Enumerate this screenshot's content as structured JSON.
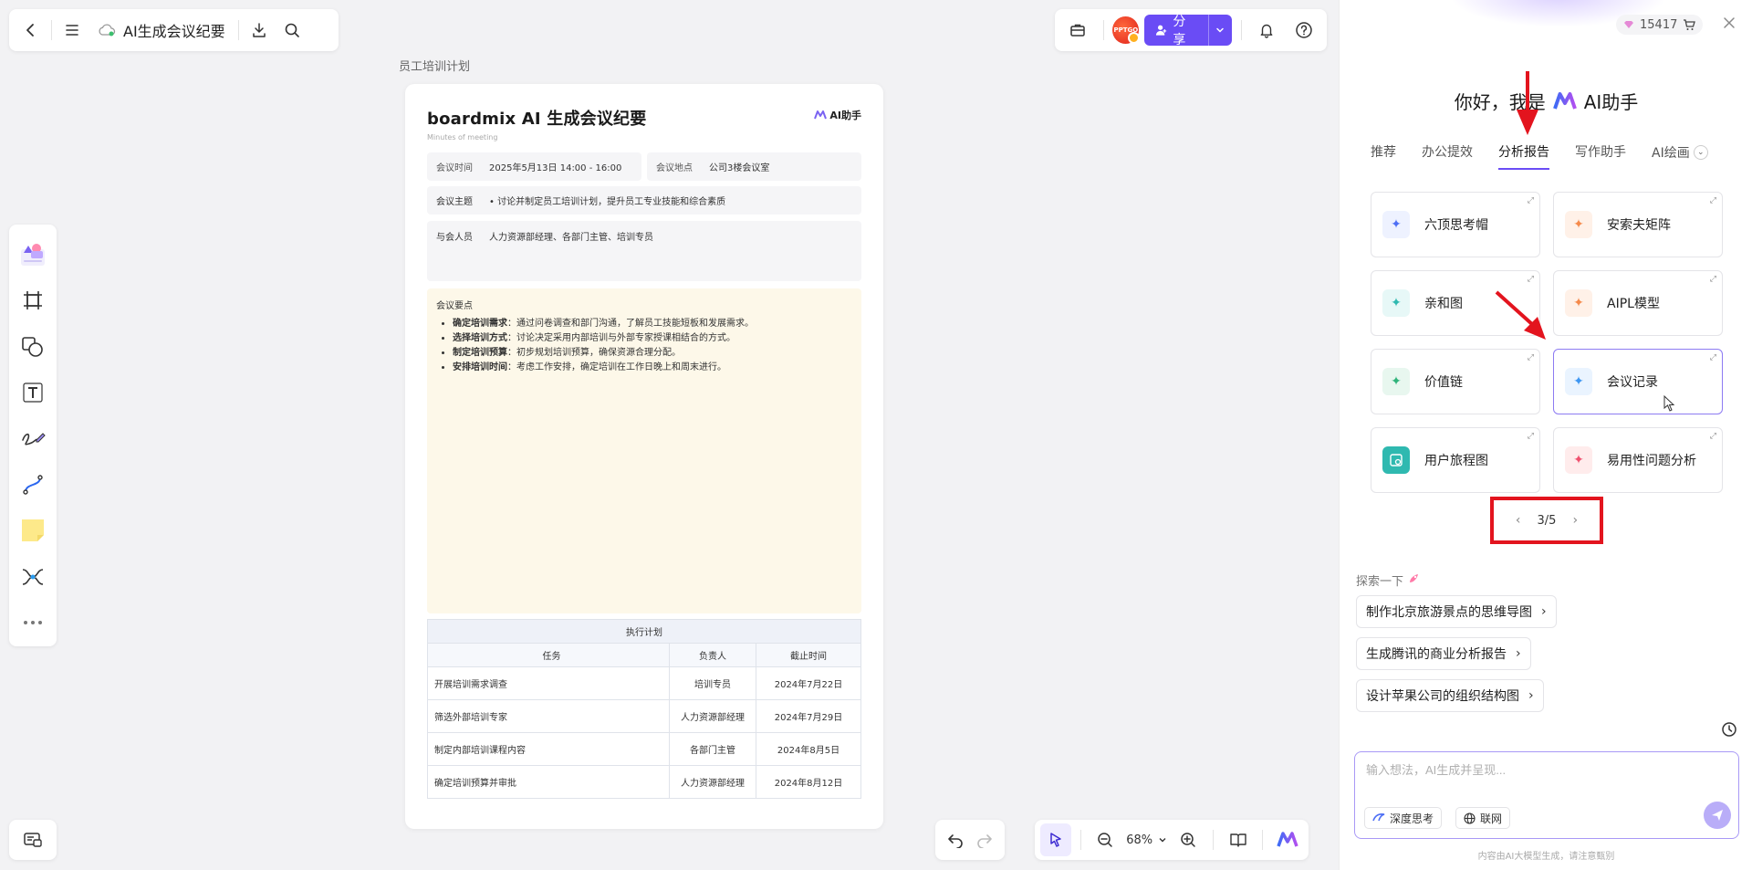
{
  "header": {
    "title": "AI生成会议纪要"
  },
  "share": {
    "label": "分享"
  },
  "avatar": {
    "text": "PPTGO"
  },
  "canvas": {
    "frame_label": "员工培训计划",
    "zoom": "68%"
  },
  "doc": {
    "title": "boardmix AI 生成会议纪要",
    "subtitle": "Minutes of meeting",
    "badge": "AI助手",
    "time_label": "会议时间",
    "time_value": "2025年5月13日 14:00 - 16:00",
    "place_label": "会议地点",
    "place_value": "公司3楼会议室",
    "topic_label": "会议主题",
    "topic_value": "讨论并制定员工培训计划，提升员工专业技能和综合素质",
    "attendees_label": "与会人员",
    "attendees_value": "人力资源部经理、各部门主管、培训专员",
    "points_title": "会议要点",
    "points": [
      {
        "k": "确定培训需求",
        "v": "：通过问卷调查和部门沟通，了解员工技能短板和发展需求。"
      },
      {
        "k": "选择培训方式",
        "v": "：讨论决定采用内部培训与外部专家授课相结合的方式。"
      },
      {
        "k": "制定培训预算",
        "v": "：初步规划培训预算，确保资源合理分配。"
      },
      {
        "k": "安排培训时间",
        "v": "：考虑工作安排，确定培训在工作日晚上和周末进行。"
      }
    ],
    "plan": {
      "caption": "执行计划",
      "headers": [
        "任务",
        "负责人",
        "截止时间"
      ],
      "rows": [
        [
          "开展培训需求调查",
          "培训专员",
          "2024年7月22日"
        ],
        [
          "筛选外部培训专家",
          "人力资源部经理",
          "2024年7月29日"
        ],
        [
          "制定内部培训课程内容",
          "各部门主管",
          "2024年8月5日"
        ],
        [
          "确定培训预算并审批",
          "人力资源部经理",
          "2024年8月12日"
        ]
      ]
    }
  },
  "ai_panel": {
    "credits": "15417",
    "greeting_prefix": "你好，我是",
    "greeting_brand": "AI助手",
    "tabs": [
      "推荐",
      "办公提效",
      "分析报告",
      "写作助手",
      "AI绘画"
    ],
    "active_tab": "分析报告",
    "cards": [
      {
        "label": "六顶思考帽",
        "icon": "sparkle-icon",
        "color": "blue"
      },
      {
        "label": "安索夫矩阵",
        "icon": "sparkle-icon",
        "color": "orange"
      },
      {
        "label": "亲和图",
        "icon": "sparkle-icon",
        "color": "cyan"
      },
      {
        "label": "AIPL模型",
        "icon": "sparkle-icon",
        "color": "orange"
      },
      {
        "label": "价值链",
        "icon": "sparkle-icon",
        "color": "green"
      },
      {
        "label": "会议记录",
        "icon": "sparkle-icon",
        "color": "sky"
      },
      {
        "label": "用户旅程图",
        "icon": "journey-icon",
        "color": "teal"
      },
      {
        "label": "易用性问题分析",
        "icon": "sparkle-icon",
        "color": "red"
      }
    ],
    "pager": "3/5",
    "explore_title": "探索一下",
    "suggestions": [
      "制作北京旅游景点的思维导图",
      "生成腾讯的商业分析报告",
      "设计苹果公司的组织结构图"
    ],
    "input_placeholder": "输入想法，AI生成并呈现...",
    "chip_think": "深度思考",
    "chip_web": "联网",
    "disclaimer": "内容由AI大模型生成，请注意甄别"
  },
  "colors": {
    "accent": "#6a4cf5",
    "annotation_red": "#e3141e",
    "notes_bg": "#fdf8e9"
  }
}
